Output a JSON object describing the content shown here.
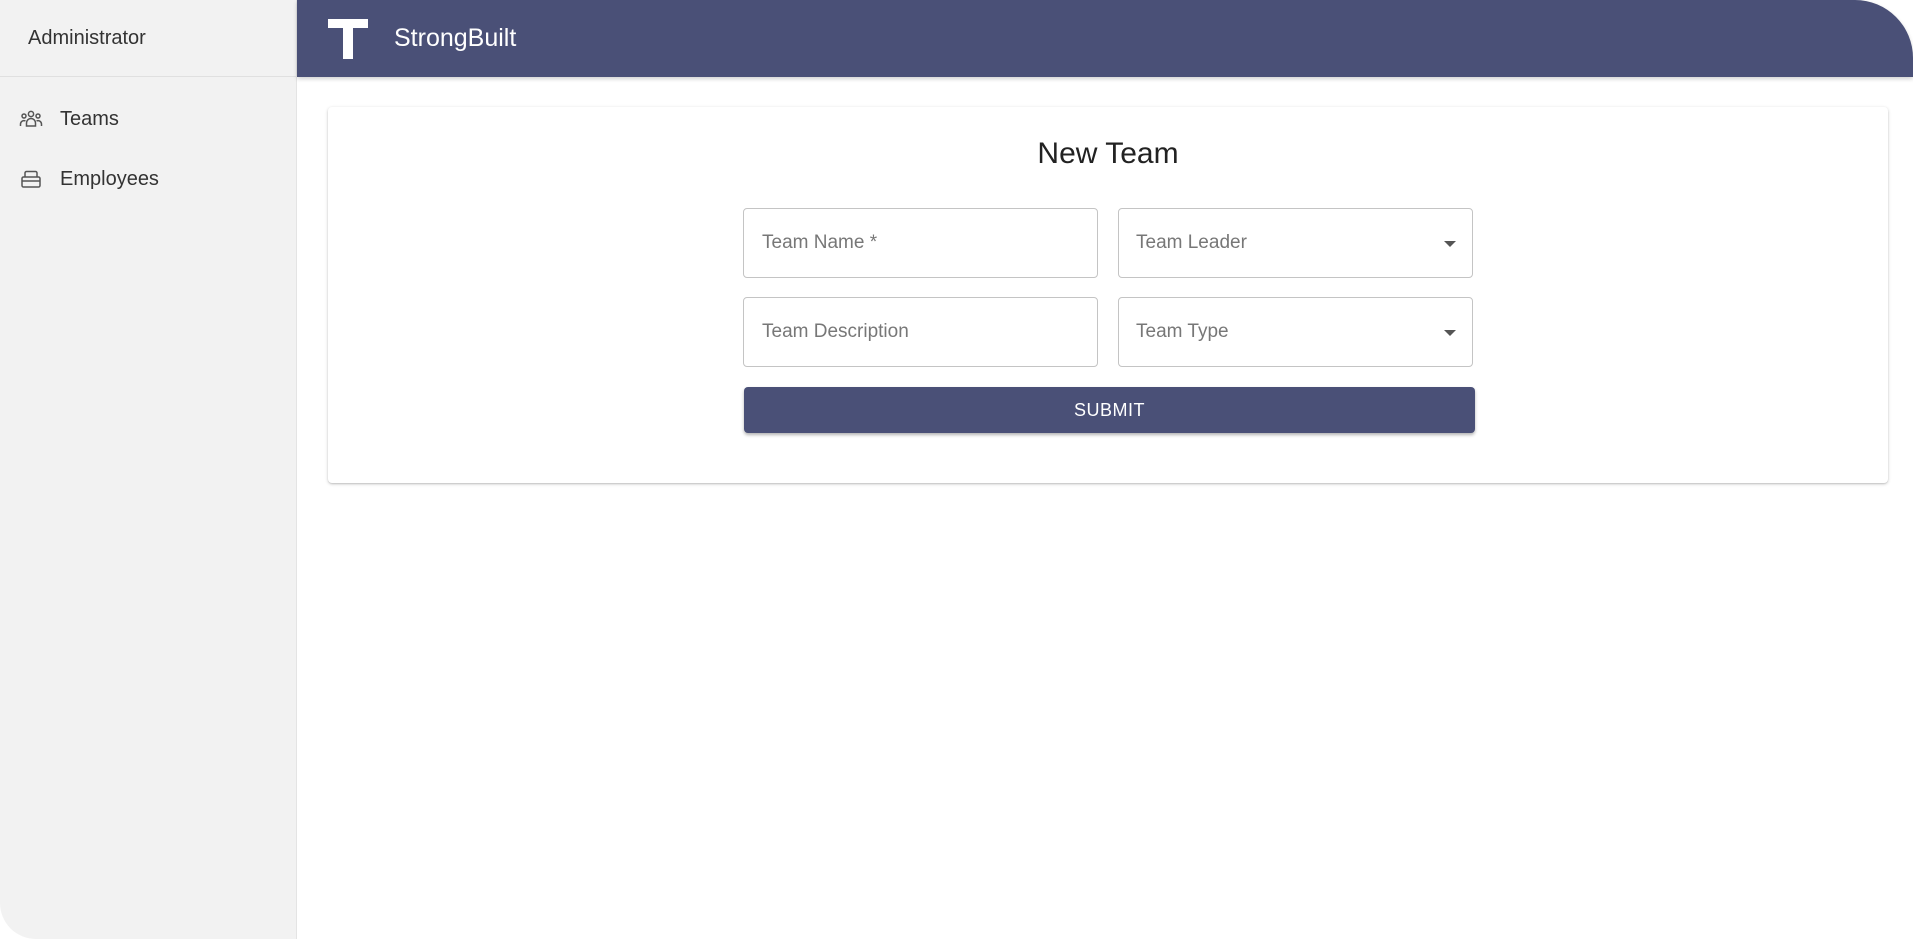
{
  "sidebar": {
    "header": "Administrator",
    "items": [
      {
        "label": "Teams",
        "icon": "people-group-icon"
      },
      {
        "label": "Employees",
        "icon": "id-card-holder-icon"
      }
    ]
  },
  "topbar": {
    "logo_icon": "t-logo-icon",
    "brand": "StrongBuilt"
  },
  "form": {
    "title": "New Team",
    "team_name_placeholder": "Team Name *",
    "team_leader_label": "Team Leader",
    "team_description_placeholder": "Team Description",
    "team_type_label": "Team Type",
    "submit_label": "SUBMIT"
  },
  "colors": {
    "primary": "#4a5077",
    "sidebar_bg": "#f2f2f2",
    "page_bg": "#ffffff"
  }
}
